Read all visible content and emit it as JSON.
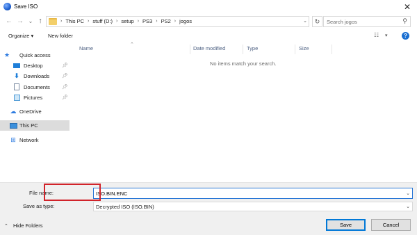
{
  "window": {
    "title": "Save ISO",
    "close_glyph": "✕"
  },
  "nav": {
    "back_glyph": "←",
    "forward_glyph": "→",
    "recent_glyph": "⌄",
    "up_glyph": "↑",
    "breadcrumbs": [
      "This PC",
      "stuff (D:)",
      "setup",
      "PS3",
      "PS2",
      "jogos"
    ],
    "refresh_glyph": "↻",
    "search_placeholder": "Search jogos"
  },
  "toolbar": {
    "organize_label": "Organize ▾",
    "new_folder_label": "New folder"
  },
  "sidebar": {
    "items": [
      {
        "label": "Quick access",
        "icon": "star-icon",
        "pinned": false
      },
      {
        "label": "Desktop",
        "icon": "desktop-icon",
        "pinned": true
      },
      {
        "label": "Downloads",
        "icon": "download-icon",
        "pinned": true
      },
      {
        "label": "Documents",
        "icon": "documents-icon",
        "pinned": true
      },
      {
        "label": "Pictures",
        "icon": "pictures-icon",
        "pinned": true
      },
      {
        "label": "OneDrive",
        "icon": "cloud-icon",
        "pinned": false
      },
      {
        "label": "This PC",
        "icon": "computer-icon",
        "pinned": false,
        "selected": true
      },
      {
        "label": "Network",
        "icon": "network-icon",
        "pinned": false
      }
    ]
  },
  "file_list": {
    "columns": [
      "Name",
      "Date modified",
      "Type",
      "Size"
    ],
    "empty_message": "No items match your search."
  },
  "save_panel": {
    "file_name_label": "File name:",
    "file_name_value": "ISO.BIN.ENC",
    "save_type_label": "Save as type:",
    "save_type_value": "Decrypted ISO (ISO.BIN)",
    "hide_folders_label": "Hide Folders",
    "save_label": "Save",
    "cancel_label": "Cancel"
  },
  "colors": {
    "accent": "#0078d7",
    "highlight_box": "#d1232a",
    "selected_bg": "#dcdcdc"
  }
}
